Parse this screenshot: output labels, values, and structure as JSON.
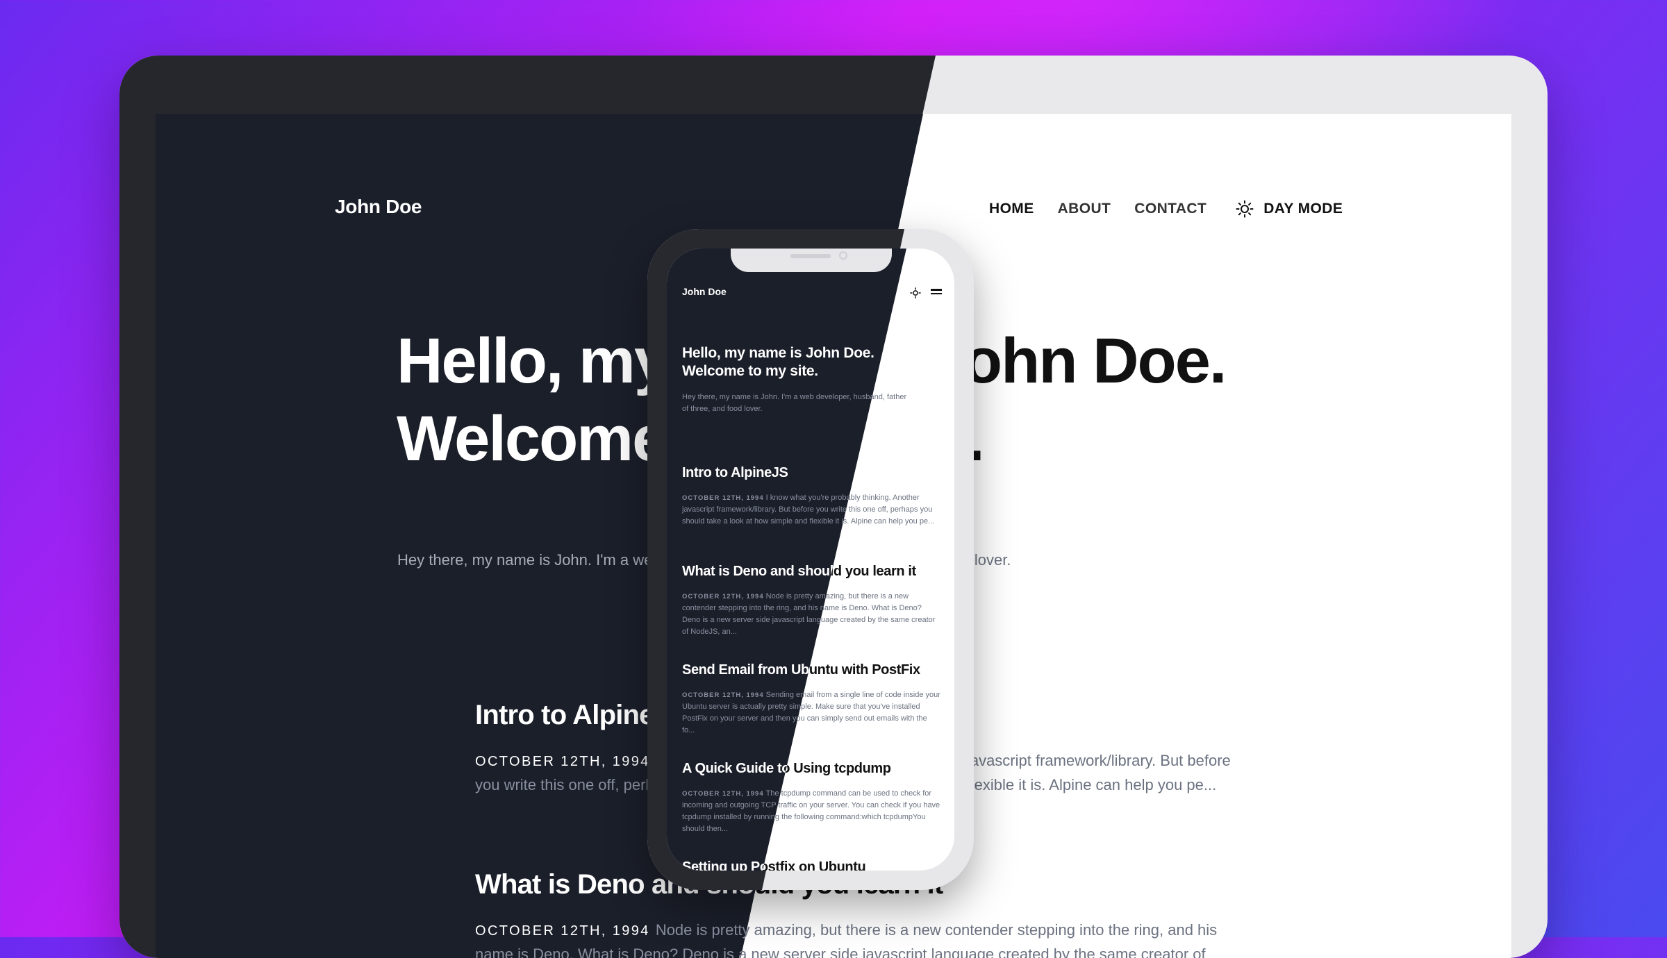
{
  "site": {
    "name": "John Doe",
    "nav": [
      {
        "label": "HOME",
        "active": true
      },
      {
        "label": "ABOUT",
        "active": false
      },
      {
        "label": "CONTACT",
        "active": false
      }
    ],
    "mode_toggle": {
      "label": "DAY MODE",
      "icon": "sun-icon"
    },
    "hero_line1": "Hello, my name is John Doe.",
    "hero_line2": "Welcome to my site.",
    "intro": "Hey there, my name is John. I'm a web developer, husband, father of three, and food lover."
  },
  "desktop_posts": [
    {
      "title": "Intro to AlpineJS",
      "date": "OCTOBER 12TH, 1994",
      "excerpt": "I know what you're probably thinking. Another javascript framework/library. But before you write this one off, perhaps you should take a look at how simple and flexible it is. Alpine can help you pe..."
    },
    {
      "title": "What is Deno and should you learn it",
      "date": "OCTOBER 12TH, 1994",
      "excerpt": "Node is pretty amazing, but there is a new contender stepping into the ring, and his name is Deno. What is Deno? Deno is a new server side javascript language created by the same creator of NodeJS, an..."
    }
  ],
  "phone": {
    "site_name": "John Doe",
    "icons": [
      "sun-icon",
      "hamburger-menu-icon"
    ],
    "hero_line1": "Hello, my name is John Doe.",
    "hero_line2": "Welcome to my site.",
    "intro": "Hey there, my name is John. I'm a web developer, husband, father of three, and food lover.",
    "posts": [
      {
        "title": "Intro to AlpineJS",
        "date": "OCTOBER 12TH, 1994",
        "excerpt": "I know what you're probably thinking. Another javascript framework/library. But before you write this one off, perhaps you should take a look at how simple and flexible it is. Alpine can help you pe..."
      },
      {
        "title": "What is Deno and should you learn it",
        "date": "OCTOBER 12TH, 1994",
        "excerpt": "Node is pretty amazing, but there is a new contender stepping into the ring, and his name is Deno. What is Deno? Deno is a new server side javascript language created by the same creator of NodeJS, an..."
      },
      {
        "title": "Send Email from Ubuntu with PostFix",
        "date": "OCTOBER 12TH, 1994",
        "excerpt": "Sending email from a single line of code inside your Ubuntu server is actually pretty simple. Make sure that you've installed PostFix on your server and then you can simply send out emails with the fo..."
      },
      {
        "title": "A Quick Guide to Using tcpdump",
        "date": "OCTOBER 12TH, 1994",
        "excerpt": "The tcpdump command can be used to check for incoming and outgoing TCP traffic on your server. You can check if you have tcpdump installed by running the following command:which tcpdumpYou should then..."
      },
      {
        "title": "Setting up Postfix on Ubuntu",
        "date": "",
        "excerpt": ""
      }
    ]
  },
  "colors": {
    "dark_bg": "#1b1f2a",
    "light_bg": "#ffffff",
    "muted_text": "#6b7280",
    "background_gradient": [
      "#6a2af0",
      "#c41df5",
      "#4a4af0"
    ]
  }
}
